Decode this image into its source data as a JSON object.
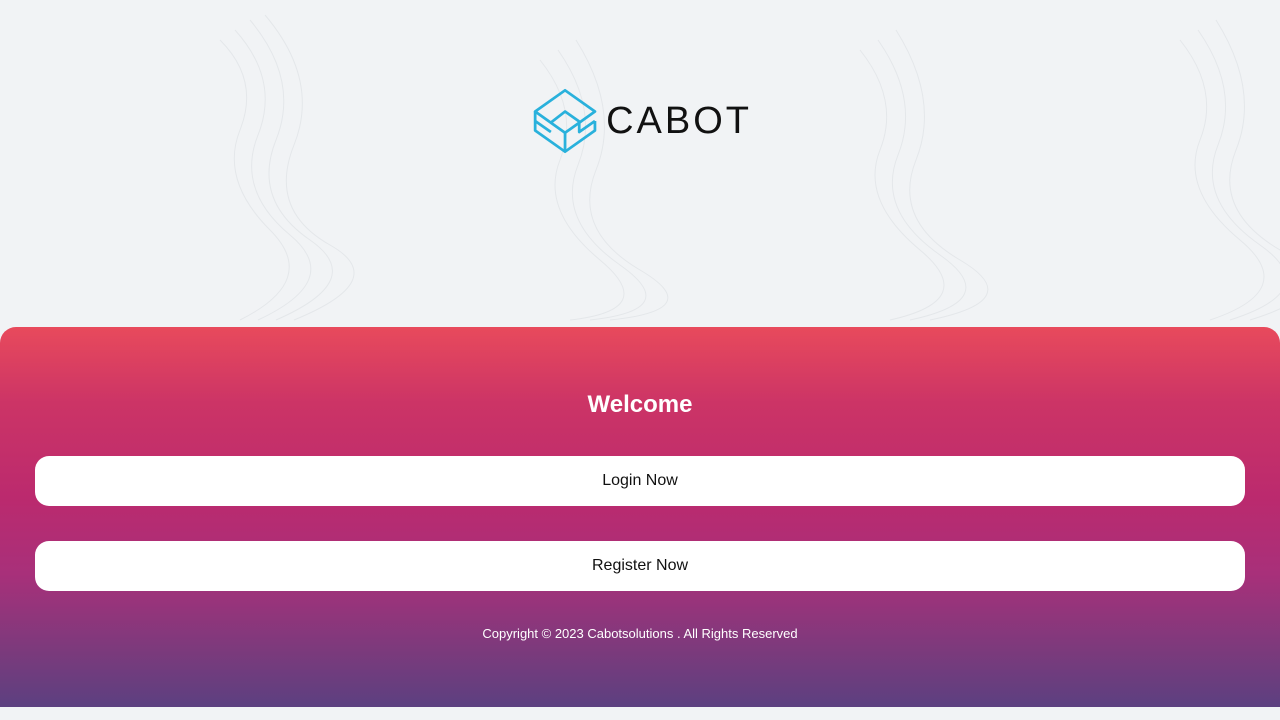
{
  "brand": {
    "name": "CABOT",
    "logo_icon": "cube-logo-icon",
    "logo_color": "#29b1dc"
  },
  "background": {
    "pattern": "topographic-contour-lines",
    "color": "#f1f3f5"
  },
  "panel": {
    "title": "Welcome",
    "gradient_colors": [
      "#e84a5c",
      "#bb2a6e",
      "#5c4080"
    ],
    "login_button": "Login Now",
    "register_button": "Register Now",
    "copyright": "Copyright © 2023 Cabotsolutions . All Rights Reserved"
  }
}
